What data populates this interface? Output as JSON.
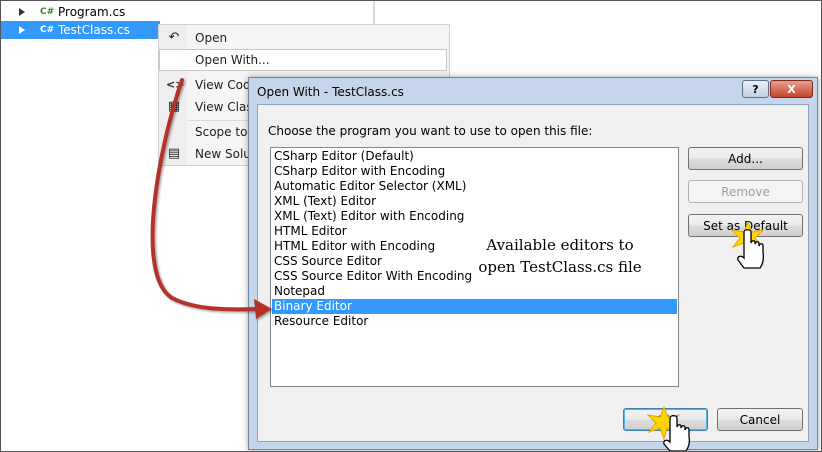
{
  "solution_explorer": {
    "items": [
      {
        "icon": "C#",
        "label": "Program.cs",
        "selected": false
      },
      {
        "icon": "C#",
        "label": "TestClass.cs",
        "selected": true
      }
    ]
  },
  "context_menu": {
    "items": [
      {
        "label": "Open",
        "icon": "open-icon"
      },
      {
        "label": "Open With...",
        "icon": "",
        "hover": true
      },
      {
        "label": "View Code",
        "icon": "code-icon"
      },
      {
        "label": "View Class",
        "icon": "class-diagram-icon"
      },
      {
        "label": "Scope to T",
        "icon": ""
      },
      {
        "label": "New Solut",
        "icon": "solution-icon"
      }
    ]
  },
  "dialog": {
    "title": "Open With - TestClass.cs",
    "help_glyph": "?",
    "close_glyph": "X",
    "prompt": "Choose the program you want to use to open this file:",
    "editors": [
      "CSharp Editor (Default)",
      "CSharp Editor with Encoding",
      "Automatic Editor Selector (XML)",
      "XML (Text) Editor",
      "XML (Text) Editor with Encoding",
      "HTML Editor",
      "HTML Editor with Encoding",
      "CSS Source Editor",
      "CSS Source Editor With Encoding",
      "Notepad",
      "Binary Editor",
      "Resource Editor"
    ],
    "selected_index": 10,
    "buttons": {
      "add": "Add...",
      "remove": "Remove",
      "set_default": "Set as Default",
      "ok": "OK",
      "cancel": "Cancel"
    }
  },
  "annotation": {
    "line1": "Available editors to",
    "line2": "open TestClass.cs file"
  },
  "colors": {
    "selection": "#3399ff",
    "arrow": "#c0392b",
    "dialog_frame": "#c6d6ea",
    "close_button": "#c7432b"
  }
}
